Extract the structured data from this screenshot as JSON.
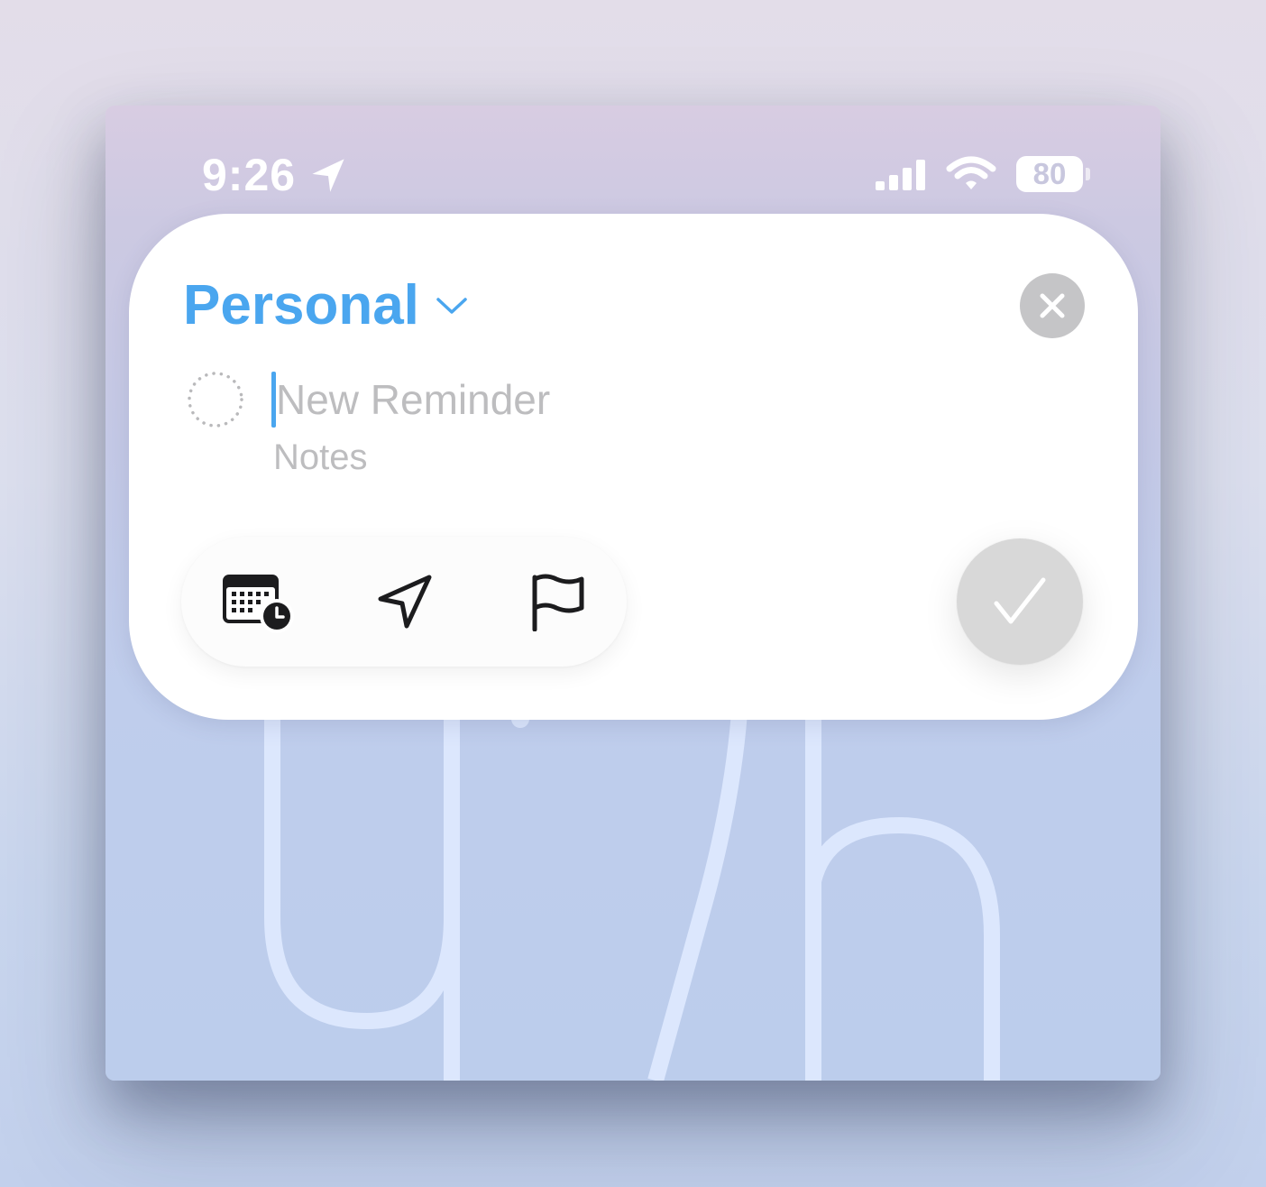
{
  "status_bar": {
    "time": "9:26",
    "battery_level": "80",
    "location_icon": "location-arrow-icon",
    "signal_icon": "cellular-signal-icon",
    "wifi_icon": "wifi-icon"
  },
  "sheet": {
    "list_name": "Personal",
    "title_placeholder": "New Reminder",
    "notes_placeholder": "Notes",
    "toolbar": [
      {
        "name": "date-time",
        "icon": "calendar-clock-icon"
      },
      {
        "name": "location",
        "icon": "location-arrow-icon"
      },
      {
        "name": "flag",
        "icon": "flag-icon"
      }
    ],
    "close_icon": "close-icon",
    "done_icon": "checkmark-icon"
  },
  "colors": {
    "accent": "#4aa6ef",
    "placeholder": "#bdbdbf",
    "close_button_bg": "#c5c5c7",
    "done_button_bg": "#d8d8d8"
  }
}
